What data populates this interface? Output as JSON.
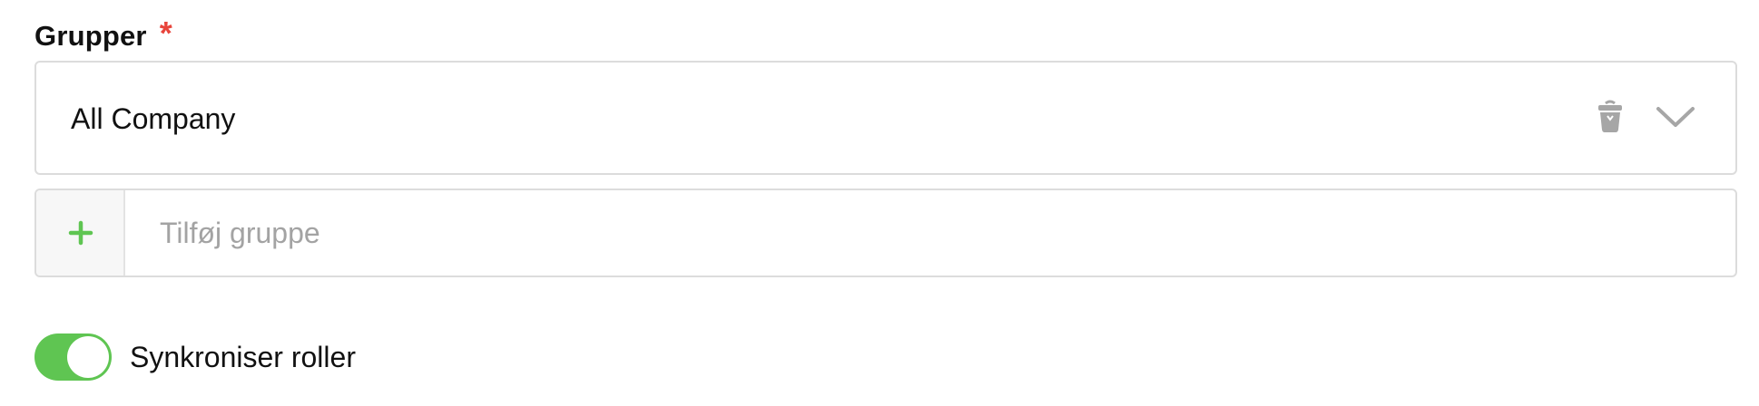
{
  "groups_field": {
    "label": "Grupper",
    "required_mark": "*",
    "selected_value": "All Company",
    "trash_icon": "trash-icon",
    "chevron_icon": "chevron-down-icon"
  },
  "add_group": {
    "plus_icon": "plus-icon",
    "placeholder": "Tilføj gruppe",
    "value": ""
  },
  "sync_roles": {
    "label": "Synkroniser roller",
    "enabled": true
  },
  "colors": {
    "required": "#e8453c",
    "accent_green": "#5fc552",
    "icon_gray": "#a6a6a6",
    "border": "#dcdcdc",
    "placeholder": "#a3a3a3"
  }
}
